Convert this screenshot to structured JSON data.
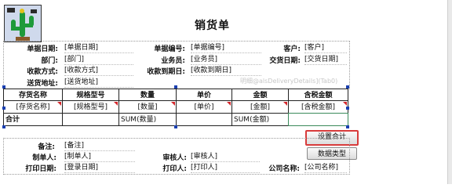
{
  "report": {
    "title": "销货单",
    "header": {
      "row1": {
        "date_label": "单据日期:",
        "date_val": "[单据日期]",
        "no_label": "单据编号:",
        "no_val": "[单据编号]",
        "cust_label": "客户:",
        "cust_val": "[客户]"
      },
      "row2": {
        "dept_label": "部门:",
        "dept_val": "[部门]",
        "sales_label": "业务员:",
        "sales_val": "[业务员]",
        "deliv_label": "交货日期:",
        "deliv_val": "[交货日期]"
      },
      "row3": {
        "pay_label": "收款方式:",
        "pay_val": "[收款方式]",
        "due_label": "收款到期日:",
        "due_val": "[收款到期日]"
      },
      "row4": {
        "addr_label": "送货地址:",
        "addr_val": "[送货地址]"
      }
    },
    "watermark": "明细@alsDeliveryDetails](Tab0)",
    "table": {
      "headers": [
        "存货名称",
        "规格型号",
        "数量",
        "单价",
        "金额",
        "含税金额"
      ],
      "data_row": [
        "[存货名称]",
        "[规格型号]",
        "[数量]",
        "[单价]",
        "[金额]",
        "[含税金额]"
      ],
      "total_label": "合计",
      "total_qty": "SUM(数量)",
      "total_amount": "SUM(金额)"
    },
    "footer": {
      "note_label": "备注:",
      "note_val": "[备注]",
      "maker_label": "制单人:",
      "maker_val": "[制单人]",
      "auditor_label": "审核人:",
      "auditor_val": "[审核人]",
      "print_date_label": "打印日期:",
      "print_date_val": "[登录日期]",
      "printer_label": "打印人:",
      "printer_val": "[打印人]",
      "company_label": "公司名称:",
      "company_val": "[公司名称]"
    },
    "buttons": {
      "set_total": "设置合计",
      "data_type": "数据类型"
    }
  },
  "colors": {
    "focus_border": "#d83b3b",
    "cell_marker": "#d4262b",
    "handle": "#1a3fb0"
  }
}
